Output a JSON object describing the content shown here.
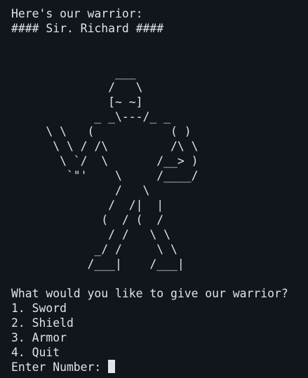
{
  "terminal": {
    "intro": "Here's our warrior:",
    "name_line": "#### Sir. Richard ####",
    "art_lines": [
      "",
      "",
      "               ___",
      "              /   \\",
      "              [~ ~]",
      "            _ _\\---/_ _",
      "     \\ \\   (           ( )",
      "      \\ \\ / /\\         /\\ \\",
      "       \\ `/  \\       /__> )",
      "        `\"'    \\     /____/",
      "               /   \\",
      "              /  /|  |",
      "             (  / (  /",
      "              / /   \\ \\",
      "            _/ /     \\ \\",
      "           /___|    /___|",
      ""
    ],
    "question": "What would you like to give our warrior?",
    "options": [
      "1. Sword",
      "2. Shield",
      "3. Armor",
      "4. Quit"
    ],
    "input_prompt": "Enter Number: "
  }
}
